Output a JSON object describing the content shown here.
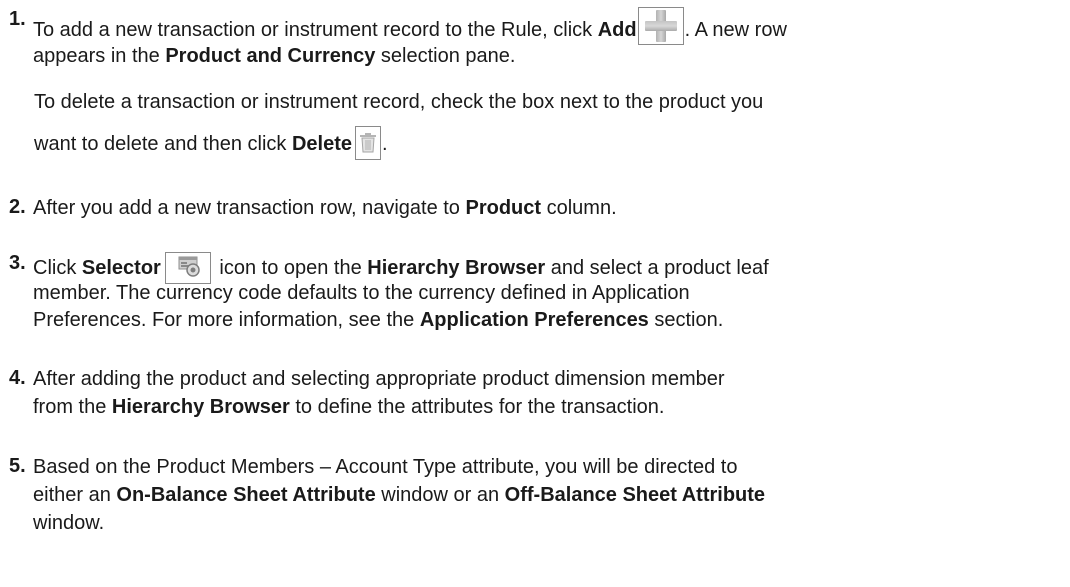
{
  "steps": [
    {
      "number": "1.",
      "lines": [
        [
          "To add a new transaction or instrument record to the Rule, click ",
          "Add",
          ". A new row"
        ],
        [
          "appears in the ",
          "Product and Currency",
          " selection pane."
        ]
      ],
      "sub_lines": [
        [
          "To delete a transaction or instrument record, check the box next to the product you"
        ],
        [
          "want to delete and then click ",
          "Delete",
          "."
        ]
      ]
    },
    {
      "number": "2.",
      "lines": [
        [
          "After you add a new transaction row, navigate to ",
          "Product",
          " column."
        ]
      ]
    },
    {
      "number": "3.",
      "lines": [
        [
          "Click ",
          "Selector",
          " icon to open the ",
          "Hierarchy Browser",
          " and select a product leaf"
        ],
        [
          "member. The currency code defaults to the currency defined in Application"
        ],
        [
          "Preferences. For more information, see the ",
          "Application Preferences",
          " section."
        ]
      ]
    },
    {
      "number": "4.",
      "lines": [
        [
          "After adding the product and selecting appropriate product dimension member"
        ],
        [
          "from the ",
          "Hierarchy Browser",
          " to define the attributes for the transaction."
        ]
      ]
    },
    {
      "number": "5.",
      "lines": [
        [
          "Based on the Product Members – Account Type attribute, you will be directed to"
        ],
        [
          "either an ",
          "On-Balance Sheet Attribute",
          " window or an ",
          "Off-Balance Sheet Attribute"
        ],
        [
          "window."
        ]
      ]
    }
  ],
  "icons": {
    "add": "plus-icon",
    "delete": "trash-icon",
    "selector": "hierarchy-selector-icon"
  }
}
